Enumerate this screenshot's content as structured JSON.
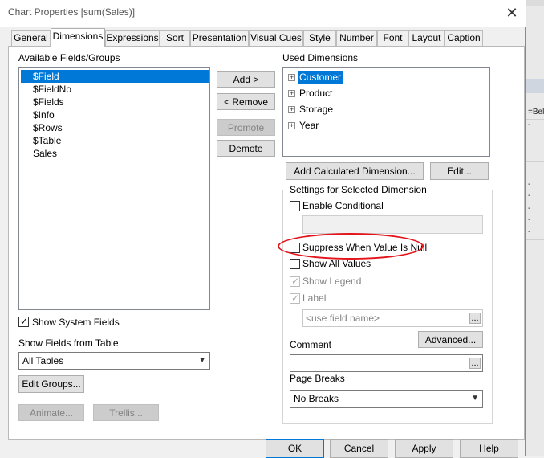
{
  "window": {
    "title": "Chart Properties [sum(Sales)]"
  },
  "tabs": [
    {
      "label": "General"
    },
    {
      "label": "Dimensions"
    },
    {
      "label": "Expressions"
    },
    {
      "label": "Sort"
    },
    {
      "label": "Presentation"
    },
    {
      "label": "Visual Cues"
    },
    {
      "label": "Style"
    },
    {
      "label": "Number"
    },
    {
      "label": "Font"
    },
    {
      "label": "Layout"
    },
    {
      "label": "Caption"
    }
  ],
  "available": {
    "label": "Available Fields/Groups",
    "items": [
      "$Field",
      "$FieldNo",
      "$Fields",
      "$Info",
      "$Rows",
      "$Table",
      "Sales"
    ],
    "selected": "$Field",
    "show_system_fields": "Show System Fields",
    "show_fields_from_table": "Show Fields from Table",
    "table_selection": "All Tables",
    "edit_groups": "Edit Groups...",
    "animate": "Animate...",
    "trellis": "Trellis..."
  },
  "middle_buttons": {
    "add": "Add >",
    "remove": "< Remove",
    "promote": "Promote",
    "demote": "Demote"
  },
  "used": {
    "label": "Used Dimensions",
    "items": [
      "Customer",
      "Product",
      "Storage",
      "Year"
    ],
    "selected": "Customer",
    "add_calculated": "Add Calculated Dimension...",
    "edit": "Edit..."
  },
  "settings": {
    "group_label": "Settings for Selected Dimension",
    "enable_conditional": "Enable Conditional",
    "suppress_null": "Suppress When Value Is Null",
    "show_all_values": "Show All Values",
    "show_legend": "Show Legend",
    "label": "Label",
    "label_placeholder": "<use field name>",
    "advanced": "Advanced...",
    "comment": "Comment",
    "page_breaks": "Page Breaks",
    "page_breaks_value": "No Breaks",
    "ellipsis": "..."
  },
  "footer": {
    "ok": "OK",
    "cancel": "Cancel",
    "apply": "Apply",
    "help": "Help"
  },
  "background_app": {
    "cell_text": "=Bel",
    "dashes": [
      "-",
      "-",
      "-",
      "-",
      "-",
      "-"
    ]
  },
  "colors": {
    "selection": "#0078d7",
    "annotation": "#e4141b"
  }
}
